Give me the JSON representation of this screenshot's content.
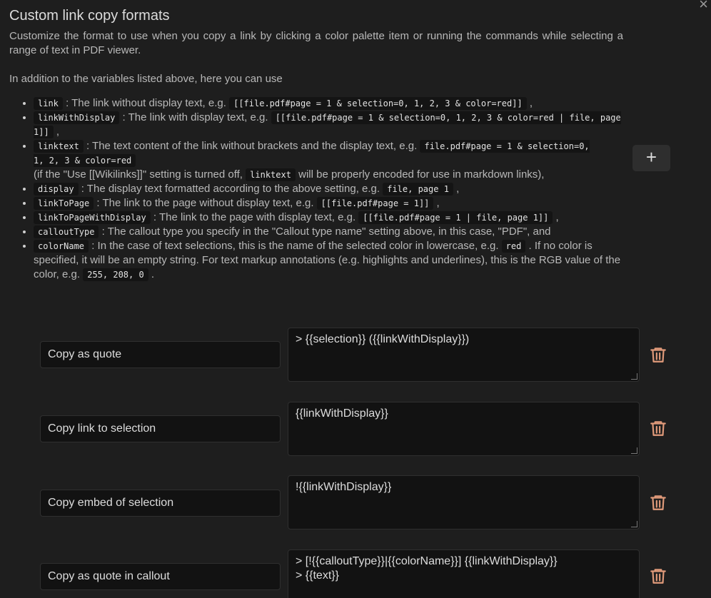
{
  "title": "Custom link copy formats",
  "close_label": "×",
  "description": "Customize the format to use when you copy a link by clicking a color palette item or running the commands while selecting a range of text in PDF viewer.",
  "additional": "In addition to the variables listed above, here you can use",
  "variables": [
    {
      "name": "link",
      "desc": " : The link without display text, e.g. ",
      "example": "[[file.pdf#page = 1 & selection=0, 1, 2, 3 & color=red]]",
      "tail": " ,"
    },
    {
      "name": "linkWithDisplay",
      "desc": " : The link with display text, e.g. ",
      "example": "[[file.pdf#page = 1 & selection=0, 1, 2, 3 & color=red | file, page 1]]",
      "tail": " ,"
    },
    {
      "name": "linktext",
      "desc": " : The text content of the link without brackets and the display text, e.g. ",
      "example": "file.pdf#page = 1 & selection=0, 1, 2, 3 & color=red",
      "note_pre": "(if the \"Use [[Wikilinks]]\" setting is turned off, ",
      "note_code": "linktext",
      "note_post": " will be properly encoded for use in markdown links),"
    },
    {
      "name": "display",
      "desc": " : The display text formatted according to the above setting, e.g. ",
      "example": "file, page 1",
      "tail": " ,"
    },
    {
      "name": "linkToPage",
      "desc": " : The link to the page without display text, e.g. ",
      "example": "[[file.pdf#page = 1]]",
      "tail": " ,"
    },
    {
      "name": "linkToPageWithDisplay",
      "desc": " : The link to the page with display text, e.g. ",
      "example": "[[file.pdf#page = 1 | file, page 1]]",
      "tail": " ,"
    },
    {
      "name": "calloutType",
      "desc": " : The callout type you specify in the \"Callout type name\" setting above, in this case, \"PDF\", and"
    },
    {
      "name": "colorName",
      "desc": " : In the case of text selections, this is the name of the selected color in lowercase, e.g. ",
      "example": "red",
      "desc2": " . If no color is specified, it will be an empty string. For text markup annotations (e.g. highlights and underlines), this is the RGB value of the color, e.g. ",
      "example2": "255, 208, 0",
      "tail": " ."
    }
  ],
  "add_label": "+",
  "formats": [
    {
      "name": "Copy as quote",
      "template": "> {{selection}} ({{linkWithDisplay}})"
    },
    {
      "name": "Copy link to selection",
      "template": "{{linkWithDisplay}}"
    },
    {
      "name": "Copy embed of selection",
      "template": "!{{linkWithDisplay}}"
    },
    {
      "name": "Copy as quote in callout",
      "template": "> [!{{calloutType}}|{{colorName}}] {{linkWithDisplay}}\n> {{text}}"
    }
  ],
  "colors": {
    "background": "#1e1e1e",
    "input_bg": "#121212",
    "trash": "#e09a7a"
  }
}
